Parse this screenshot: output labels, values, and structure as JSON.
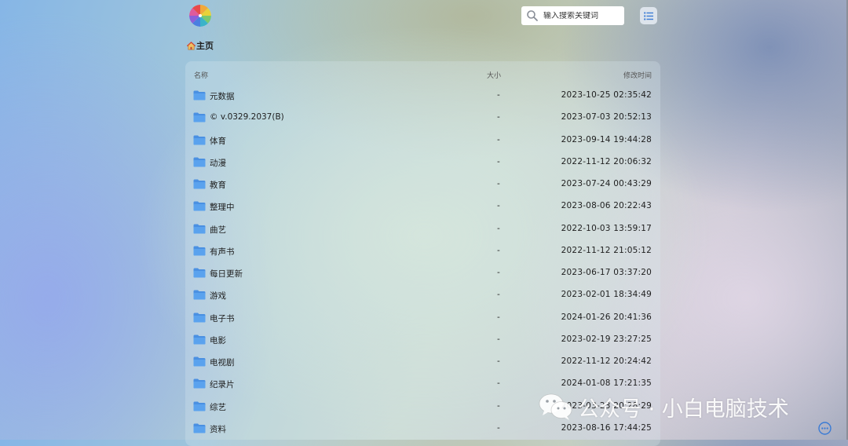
{
  "header": {
    "logo_icon": "colorful-pinwheel-logo",
    "search": {
      "placeholder": "输入搜索关键词",
      "icon": "search-icon"
    },
    "view_toggle_icon": "list-view-icon"
  },
  "breadcrumb": {
    "icon": "home-icon",
    "label": "主页"
  },
  "file_list": {
    "columns": {
      "name": "名称",
      "size": "大小",
      "modified": "修改时间"
    },
    "rows": [
      {
        "name": "元数据",
        "size": "-",
        "modified": "2023-10-25 02:35:42"
      },
      {
        "name": "© v.0329.2037(B)",
        "size": "-",
        "modified": "2023-07-03 20:52:13"
      },
      {
        "name": "体育",
        "size": "-",
        "modified": "2023-09-14 19:44:28"
      },
      {
        "name": "动漫",
        "size": "-",
        "modified": "2022-11-12 20:06:32"
      },
      {
        "name": "教育",
        "size": "-",
        "modified": "2023-07-24 00:43:29"
      },
      {
        "name": "整理中",
        "size": "-",
        "modified": "2023-08-06 20:22:43"
      },
      {
        "name": "曲艺",
        "size": "-",
        "modified": "2022-10-03 13:59:17"
      },
      {
        "name": "有声书",
        "size": "-",
        "modified": "2022-11-12 21:05:12"
      },
      {
        "name": "每日更新",
        "size": "-",
        "modified": "2023-06-17 03:37:20"
      },
      {
        "name": "游戏",
        "size": "-",
        "modified": "2023-02-01 18:34:49"
      },
      {
        "name": "电子书",
        "size": "-",
        "modified": "2024-01-26 20:41:36"
      },
      {
        "name": "电影",
        "size": "-",
        "modified": "2023-02-19 23:27:25"
      },
      {
        "name": "电视剧",
        "size": "-",
        "modified": "2022-11-12 20:24:42"
      },
      {
        "name": "纪录片",
        "size": "-",
        "modified": "2024-01-08 17:21:35"
      },
      {
        "name": "综艺",
        "size": "-",
        "modified": "2023-03-23 20:28:29"
      },
      {
        "name": "资料",
        "size": "-",
        "modified": "2023-08-16 17:44:25"
      }
    ],
    "folder_icon": "folder-icon",
    "folder_color": "#4a90e2"
  },
  "watermark": {
    "icon": "wechat-icon",
    "text": "公众号 · 小白电脑技术"
  },
  "more_button_icon": "more-options-icon",
  "colors": {
    "accent": "#3a7bd5",
    "folder": "#4a90e2"
  }
}
